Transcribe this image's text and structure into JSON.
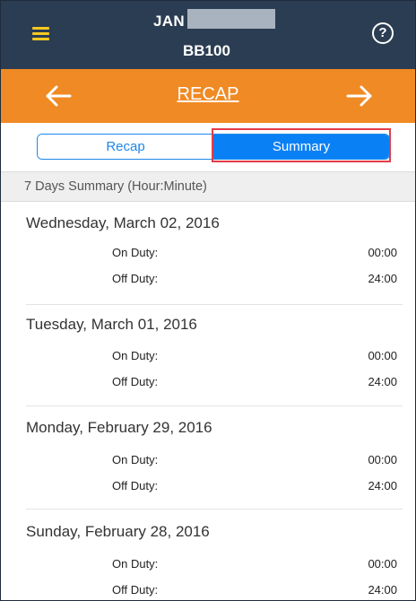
{
  "header": {
    "driver_name": "JAN",
    "vehicle_id": "BB100",
    "help_glyph": "?"
  },
  "nav": {
    "title": "RECAP",
    "prev_icon": "arrow-left-icon",
    "next_icon": "arrow-right-icon"
  },
  "tabs": {
    "recap_label": "Recap",
    "summary_label": "Summary",
    "selected": "Summary"
  },
  "summary": {
    "header": "7 Days Summary (Hour:Minute)",
    "days": [
      {
        "date": "Wednesday, March 02, 2016",
        "on_duty_label": "On Duty:",
        "on_duty": "00:00",
        "off_duty_label": "Off Duty:",
        "off_duty": "24:00"
      },
      {
        "date": "Tuesday, March 01, 2016",
        "on_duty_label": "On Duty:",
        "on_duty": "00:00",
        "off_duty_label": "Off Duty:",
        "off_duty": "24:00"
      },
      {
        "date": "Monday, February 29, 2016",
        "on_duty_label": "On Duty:",
        "on_duty": "00:00",
        "off_duty_label": "Off Duty:",
        "off_duty": "24:00"
      },
      {
        "date": "Sunday, February 28, 2016",
        "on_duty_label": "On Duty:",
        "on_duty": "00:00",
        "off_duty_label": "Off Duty:",
        "off_duty": "24:00"
      }
    ]
  },
  "colors": {
    "topbar": "#2b3d52",
    "navbar": "#f08a24",
    "menu_accent": "#f5c81f",
    "segment_blue": "#0a80f5",
    "highlight_red": "#e23c47"
  }
}
